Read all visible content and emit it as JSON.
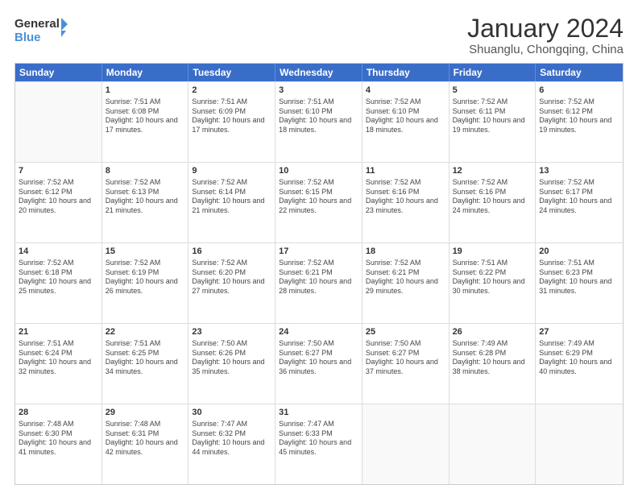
{
  "header": {
    "logo_line1": "General",
    "logo_line2": "Blue",
    "title": "January 2024",
    "subtitle": "Shuanglu, Chongqing, China"
  },
  "days_of_week": [
    "Sunday",
    "Monday",
    "Tuesday",
    "Wednesday",
    "Thursday",
    "Friday",
    "Saturday"
  ],
  "weeks": [
    [
      {
        "day": "",
        "sunrise": "",
        "sunset": "",
        "daylight": ""
      },
      {
        "day": "1",
        "sunrise": "Sunrise: 7:51 AM",
        "sunset": "Sunset: 6:08 PM",
        "daylight": "Daylight: 10 hours and 17 minutes."
      },
      {
        "day": "2",
        "sunrise": "Sunrise: 7:51 AM",
        "sunset": "Sunset: 6:09 PM",
        "daylight": "Daylight: 10 hours and 17 minutes."
      },
      {
        "day": "3",
        "sunrise": "Sunrise: 7:51 AM",
        "sunset": "Sunset: 6:10 PM",
        "daylight": "Daylight: 10 hours and 18 minutes."
      },
      {
        "day": "4",
        "sunrise": "Sunrise: 7:52 AM",
        "sunset": "Sunset: 6:10 PM",
        "daylight": "Daylight: 10 hours and 18 minutes."
      },
      {
        "day": "5",
        "sunrise": "Sunrise: 7:52 AM",
        "sunset": "Sunset: 6:11 PM",
        "daylight": "Daylight: 10 hours and 19 minutes."
      },
      {
        "day": "6",
        "sunrise": "Sunrise: 7:52 AM",
        "sunset": "Sunset: 6:12 PM",
        "daylight": "Daylight: 10 hours and 19 minutes."
      }
    ],
    [
      {
        "day": "7",
        "sunrise": "Sunrise: 7:52 AM",
        "sunset": "Sunset: 6:12 PM",
        "daylight": "Daylight: 10 hours and 20 minutes."
      },
      {
        "day": "8",
        "sunrise": "Sunrise: 7:52 AM",
        "sunset": "Sunset: 6:13 PM",
        "daylight": "Daylight: 10 hours and 21 minutes."
      },
      {
        "day": "9",
        "sunrise": "Sunrise: 7:52 AM",
        "sunset": "Sunset: 6:14 PM",
        "daylight": "Daylight: 10 hours and 21 minutes."
      },
      {
        "day": "10",
        "sunrise": "Sunrise: 7:52 AM",
        "sunset": "Sunset: 6:15 PM",
        "daylight": "Daylight: 10 hours and 22 minutes."
      },
      {
        "day": "11",
        "sunrise": "Sunrise: 7:52 AM",
        "sunset": "Sunset: 6:16 PM",
        "daylight": "Daylight: 10 hours and 23 minutes."
      },
      {
        "day": "12",
        "sunrise": "Sunrise: 7:52 AM",
        "sunset": "Sunset: 6:16 PM",
        "daylight": "Daylight: 10 hours and 24 minutes."
      },
      {
        "day": "13",
        "sunrise": "Sunrise: 7:52 AM",
        "sunset": "Sunset: 6:17 PM",
        "daylight": "Daylight: 10 hours and 24 minutes."
      }
    ],
    [
      {
        "day": "14",
        "sunrise": "Sunrise: 7:52 AM",
        "sunset": "Sunset: 6:18 PM",
        "daylight": "Daylight: 10 hours and 25 minutes."
      },
      {
        "day": "15",
        "sunrise": "Sunrise: 7:52 AM",
        "sunset": "Sunset: 6:19 PM",
        "daylight": "Daylight: 10 hours and 26 minutes."
      },
      {
        "day": "16",
        "sunrise": "Sunrise: 7:52 AM",
        "sunset": "Sunset: 6:20 PM",
        "daylight": "Daylight: 10 hours and 27 minutes."
      },
      {
        "day": "17",
        "sunrise": "Sunrise: 7:52 AM",
        "sunset": "Sunset: 6:21 PM",
        "daylight": "Daylight: 10 hours and 28 minutes."
      },
      {
        "day": "18",
        "sunrise": "Sunrise: 7:52 AM",
        "sunset": "Sunset: 6:21 PM",
        "daylight": "Daylight: 10 hours and 29 minutes."
      },
      {
        "day": "19",
        "sunrise": "Sunrise: 7:51 AM",
        "sunset": "Sunset: 6:22 PM",
        "daylight": "Daylight: 10 hours and 30 minutes."
      },
      {
        "day": "20",
        "sunrise": "Sunrise: 7:51 AM",
        "sunset": "Sunset: 6:23 PM",
        "daylight": "Daylight: 10 hours and 31 minutes."
      }
    ],
    [
      {
        "day": "21",
        "sunrise": "Sunrise: 7:51 AM",
        "sunset": "Sunset: 6:24 PM",
        "daylight": "Daylight: 10 hours and 32 minutes."
      },
      {
        "day": "22",
        "sunrise": "Sunrise: 7:51 AM",
        "sunset": "Sunset: 6:25 PM",
        "daylight": "Daylight: 10 hours and 34 minutes."
      },
      {
        "day": "23",
        "sunrise": "Sunrise: 7:50 AM",
        "sunset": "Sunset: 6:26 PM",
        "daylight": "Daylight: 10 hours and 35 minutes."
      },
      {
        "day": "24",
        "sunrise": "Sunrise: 7:50 AM",
        "sunset": "Sunset: 6:27 PM",
        "daylight": "Daylight: 10 hours and 36 minutes."
      },
      {
        "day": "25",
        "sunrise": "Sunrise: 7:50 AM",
        "sunset": "Sunset: 6:27 PM",
        "daylight": "Daylight: 10 hours and 37 minutes."
      },
      {
        "day": "26",
        "sunrise": "Sunrise: 7:49 AM",
        "sunset": "Sunset: 6:28 PM",
        "daylight": "Daylight: 10 hours and 38 minutes."
      },
      {
        "day": "27",
        "sunrise": "Sunrise: 7:49 AM",
        "sunset": "Sunset: 6:29 PM",
        "daylight": "Daylight: 10 hours and 40 minutes."
      }
    ],
    [
      {
        "day": "28",
        "sunrise": "Sunrise: 7:48 AM",
        "sunset": "Sunset: 6:30 PM",
        "daylight": "Daylight: 10 hours and 41 minutes."
      },
      {
        "day": "29",
        "sunrise": "Sunrise: 7:48 AM",
        "sunset": "Sunset: 6:31 PM",
        "daylight": "Daylight: 10 hours and 42 minutes."
      },
      {
        "day": "30",
        "sunrise": "Sunrise: 7:47 AM",
        "sunset": "Sunset: 6:32 PM",
        "daylight": "Daylight: 10 hours and 44 minutes."
      },
      {
        "day": "31",
        "sunrise": "Sunrise: 7:47 AM",
        "sunset": "Sunset: 6:33 PM",
        "daylight": "Daylight: 10 hours and 45 minutes."
      },
      {
        "day": "",
        "sunrise": "",
        "sunset": "",
        "daylight": ""
      },
      {
        "day": "",
        "sunrise": "",
        "sunset": "",
        "daylight": ""
      },
      {
        "day": "",
        "sunrise": "",
        "sunset": "",
        "daylight": ""
      }
    ]
  ]
}
